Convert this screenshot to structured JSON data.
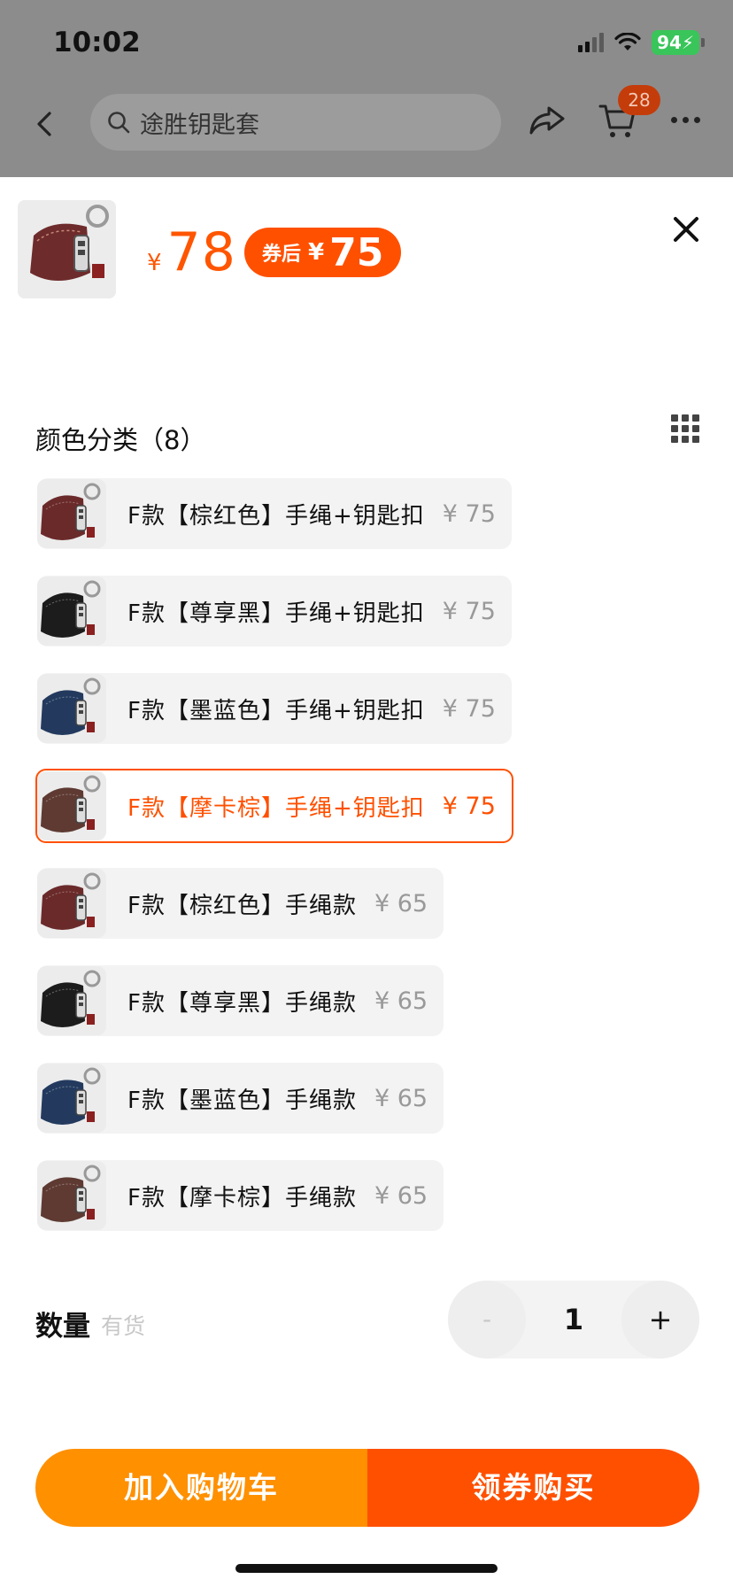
{
  "status_bar": {
    "time": "10:02",
    "battery": "94"
  },
  "nav": {
    "search_placeholder": "途胜钥匙套",
    "cart_count": "28"
  },
  "product": {
    "price_symbol": "¥",
    "price": "78",
    "coupon_label": "券后",
    "coupon_symbol": "¥",
    "coupon_price": "75"
  },
  "colors": {
    "accent": "#ff5000",
    "add_cart": "#ff9000",
    "option_bg": "#f3f3f3",
    "price_muted": "#999999"
  },
  "variants": {
    "title": "颜色分类（8）",
    "options": [
      {
        "label": "F款【棕红色】手绳+钥匙扣",
        "price": "¥ 75",
        "selected": false,
        "swatch": "#6b2a2a"
      },
      {
        "label": "F款【尊享黑】手绳+钥匙扣",
        "price": "¥ 75",
        "selected": false,
        "swatch": "#1c1c1c"
      },
      {
        "label": "F款【墨蓝色】手绳+钥匙扣",
        "price": "¥ 75",
        "selected": false,
        "swatch": "#233a5e"
      },
      {
        "label": "F款【摩卡棕】手绳+钥匙扣",
        "price": "¥ 75",
        "selected": true,
        "swatch": "#5e3a32"
      },
      {
        "label": "F款【棕红色】手绳款",
        "price": "¥ 65",
        "selected": false,
        "swatch": "#6b2a2a"
      },
      {
        "label": "F款【尊享黑】手绳款",
        "price": "¥ 65",
        "selected": false,
        "swatch": "#1c1c1c"
      },
      {
        "label": "F款【墨蓝色】手绳款",
        "price": "¥ 65",
        "selected": false,
        "swatch": "#233a5e"
      },
      {
        "label": "F款【摩卡棕】手绳款",
        "price": "¥ 65",
        "selected": false,
        "swatch": "#5e3a32"
      }
    ]
  },
  "quantity": {
    "label": "数量",
    "stock": "有货",
    "minus": "-",
    "value": "1",
    "plus": "+"
  },
  "actions": {
    "add_to_cart": "加入购物车",
    "buy_with_coupon": "领券购买"
  }
}
